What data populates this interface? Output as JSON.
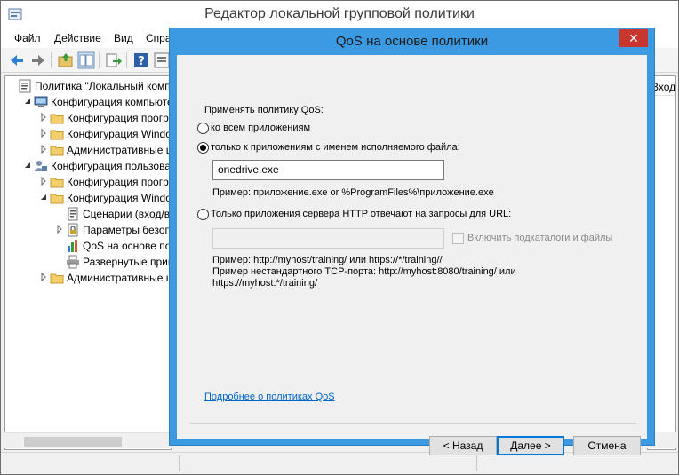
{
  "main_window": {
    "title": "Редактор локальной групповой политики",
    "menu": [
      "Файл",
      "Действие",
      "Вид",
      "Справка"
    ],
    "right_header": "Входн"
  },
  "tree": [
    {
      "label": "Политика \"Локальный компьютер\"",
      "icon": "policy-icon",
      "expander": ""
    },
    {
      "label": "Конфигурация компьютера",
      "icon": "computer-icon",
      "expander": "expanded"
    },
    {
      "label": "Конфигурация программ",
      "icon": "folder-icon",
      "expander": "collapsed"
    },
    {
      "label": "Конфигурация Windows",
      "icon": "folder-icon",
      "expander": "collapsed"
    },
    {
      "label": "Административные шаблоны",
      "icon": "folder-icon",
      "expander": "collapsed"
    },
    {
      "label": "Конфигурация пользователя",
      "icon": "user-icon",
      "expander": "expanded"
    },
    {
      "label": "Конфигурация программ",
      "icon": "folder-icon",
      "expander": "collapsed"
    },
    {
      "label": "Конфигурация Windows",
      "icon": "folder-icon",
      "expander": "expanded"
    },
    {
      "label": "Сценарии (вход/выход)",
      "icon": "script-icon",
      "expander": ""
    },
    {
      "label": "Параметры безопасности",
      "icon": "security-icon",
      "expander": "collapsed"
    },
    {
      "label": "QoS на основе политики",
      "icon": "bar-chart-icon",
      "expander": ""
    },
    {
      "label": "Развернутые принтеры",
      "icon": "printer-icon",
      "expander": ""
    },
    {
      "label": "Административные шаблоны",
      "icon": "folder-icon",
      "expander": "collapsed"
    }
  ],
  "dialog": {
    "title": "QoS на основе политики",
    "close_label": "✕",
    "apply_label": "Применять политику QoS:",
    "option_all": "ко всем приложениям",
    "option_exe": "только к приложениям с именем исполняемого файла:",
    "exe_value": "onedrive.exe",
    "exe_example": "Пример:  приложение.exe or %ProgramFiles%\\приложение.exe",
    "option_http": "Только приложения сервера HTTP отвечают на запросы для URL:",
    "url_value": "",
    "include_subdirs_label": "Включить подкаталоги и файлы",
    "include_subdirs_checked": false,
    "http_example_1": "Пример:  http://myhost/training/ или https://*/training//",
    "http_example_2": "Пример нестандартного TCP-порта:  http://myhost:8080/training/ или",
    "http_example_3": "https://myhost:*/training/",
    "learn_more_link": "Подробнее о политиках QoS",
    "selected_option": "exe",
    "buttons": {
      "back": "< Назад",
      "next": "Далее >",
      "cancel": "Отмена"
    }
  },
  "colors": {
    "dialog_frame": "#3b9ae1",
    "close_button": "#c7372f",
    "link": "#0066cc",
    "default_button_border": "#0078d7"
  }
}
